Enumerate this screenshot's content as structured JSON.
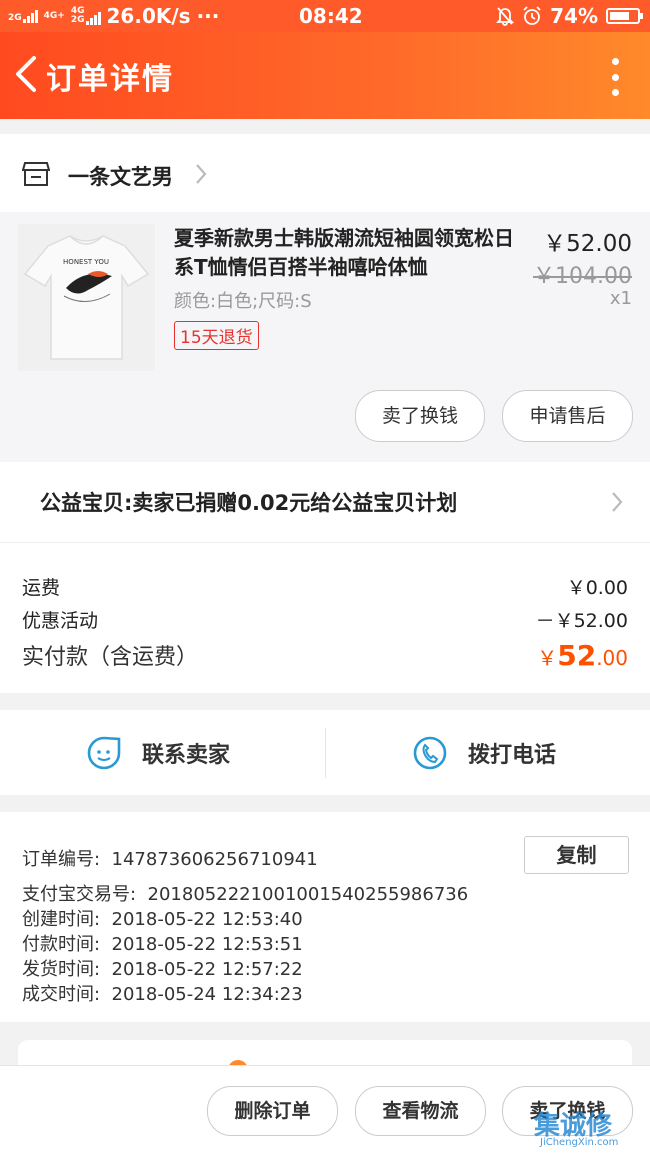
{
  "status_bar": {
    "network_1": "2G",
    "network_2": "4G+",
    "network_3": "4G",
    "network_4": "2G",
    "speed": "26.0K/s",
    "dots": "···",
    "time": "08:42",
    "battery": "74%",
    "battery_level": 0.74
  },
  "nav": {
    "title": "订单详情"
  },
  "shop": {
    "name": "一条文艺男"
  },
  "product": {
    "title": "夏季新款男士韩版潮流短袖圆领宽松日系T恤情侣百搭半袖嘻哈体恤",
    "spec": "颜色:白色;尺码:S",
    "badge": "15天退货",
    "price": "￥52.00",
    "original_price": "￥104.00",
    "quantity": "x1",
    "thumb_print_text": "HONEST YOU",
    "button_sell": "卖了换钱",
    "button_aftersale": "申请售后"
  },
  "charity": {
    "text": "公益宝贝:卖家已捐赠0.02元给公益宝贝计划"
  },
  "fees": {
    "shipping_label": "运费",
    "shipping_value": "￥0.00",
    "discount_label": "优惠活动",
    "discount_value": "－￥52.00",
    "paid_label": "实付款（含运费）",
    "paid_currency": "￥",
    "paid_int": "52",
    "paid_dec": ".00"
  },
  "contact": {
    "seller_label": "联系卖家",
    "call_label": "拨打电话"
  },
  "order_info": {
    "copy_label": "复制",
    "rows": [
      {
        "label": "订单编号:",
        "value": "147873606256710941"
      },
      {
        "label": "支付宝交易号:",
        "value": "2018052221001001540255986736"
      },
      {
        "label": "创建时间:",
        "value": "2018-05-22 12:53:40"
      },
      {
        "label": "付款时间:",
        "value": "2018-05-22 12:53:51"
      },
      {
        "label": "发货时间:",
        "value": "2018-05-22 12:57:22"
      },
      {
        "label": "成交时间:",
        "value": "2018-05-24 12:34:23"
      }
    ]
  },
  "bottom": {
    "delete": "删除订单",
    "logistics": "查看物流",
    "sell": "卖了换钱"
  },
  "watermark": {
    "main": "集诚修",
    "sub": "JiChengXin.com"
  },
  "colors": {
    "accent": "#ff5000",
    "nav": "#ff5a2a",
    "icon_blue": "#2a9ad4",
    "badge_red": "#e8322f"
  }
}
